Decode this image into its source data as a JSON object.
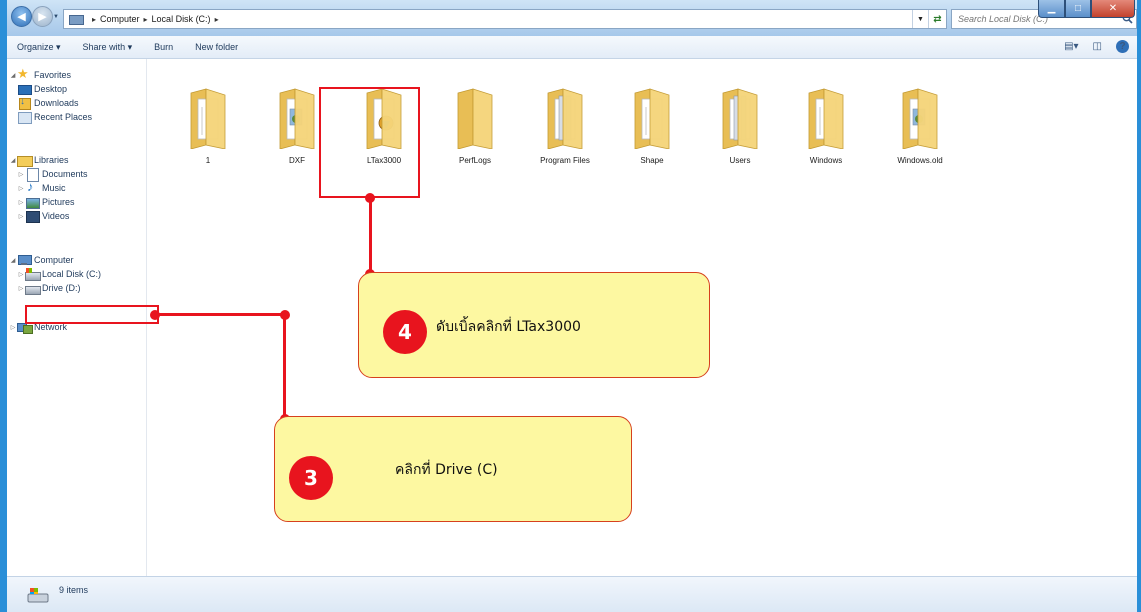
{
  "window": {
    "controls": {
      "minimize": "▁",
      "maximize": "□",
      "close": "✕"
    }
  },
  "nav": {
    "back_icon": "arrow-left-icon",
    "forward_icon": "arrow-right-icon"
  },
  "address": {
    "separator": "▸",
    "breadcrumbs": [
      "Computer",
      "Local Disk (C:)"
    ],
    "trailing_separator": "▸"
  },
  "search": {
    "placeholder": "Search Local Disk (C:)"
  },
  "toolbar": {
    "organize": "Organize ▾",
    "share_with": "Share with ▾",
    "burn": "Burn",
    "new_folder": "New folder"
  },
  "sidebar": {
    "favorites": {
      "label": "Favorites",
      "items": [
        "Desktop",
        "Downloads",
        "Recent Places"
      ]
    },
    "libraries": {
      "label": "Libraries",
      "items": [
        "Documents",
        "Music",
        "Pictures",
        "Videos"
      ]
    },
    "computer": {
      "label": "Computer",
      "items": [
        "Local Disk (C:)",
        "Drive (D:)"
      ]
    },
    "network": {
      "label": "Network"
    }
  },
  "folders": [
    {
      "name": "1",
      "variant": "papers"
    },
    {
      "name": "DXF",
      "variant": "images"
    },
    {
      "name": "LTax3000",
      "variant": "app"
    },
    {
      "name": "PerfLogs",
      "variant": "empty"
    },
    {
      "name": "Program Files",
      "variant": "files"
    },
    {
      "name": "Shape",
      "variant": "papers"
    },
    {
      "name": "Users",
      "variant": "files"
    },
    {
      "name": "Windows",
      "variant": "papers"
    },
    {
      "name": "Windows.old",
      "variant": "images"
    }
  ],
  "status": {
    "count": "9 items"
  },
  "annotations": {
    "step4": {
      "number": "4",
      "text": "ดับเบิ้ลคลิกที่ LTax3000"
    },
    "step3": {
      "number": "3",
      "text": "คลิกที่   Drive (C)"
    }
  },
  "colors": {
    "frame": "#2a8fd8",
    "annotation_red": "#e8141e",
    "callout_fill": "#fdf8a1",
    "folder_yellow": "#f5d57a"
  }
}
